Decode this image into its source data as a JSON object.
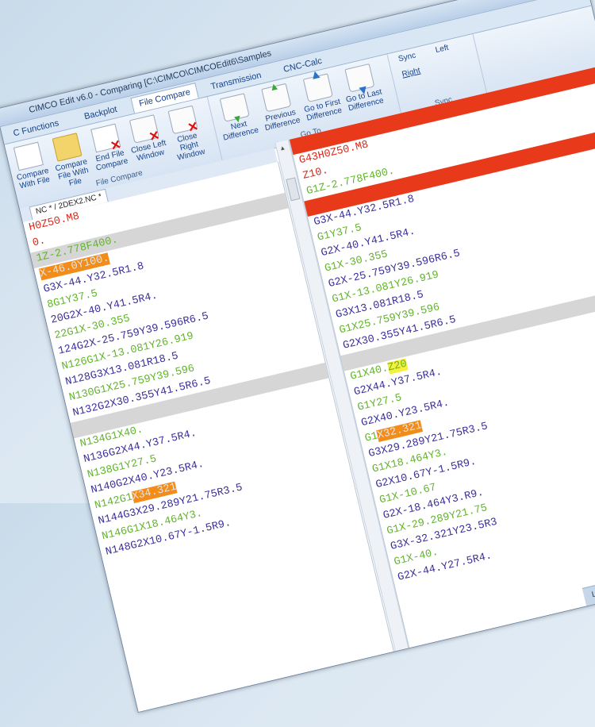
{
  "window": {
    "title": "CIMCO Edit v6.0 - Comparing [C:\\CIMCO\\CIMCOEdit6\\Samples"
  },
  "ribbon_tabs": [
    "C Functions",
    "Backplot",
    "File Compare",
    "Transmission",
    "CNC-Calc"
  ],
  "ribbon": {
    "file_compare_group": {
      "label": "File Compare",
      "buttons": [
        {
          "label": "Compare With File",
          "icon": "compare-file-icon"
        },
        {
          "label": "Compare File With File",
          "icon": "folder-icon"
        },
        {
          "label": "End File Compare",
          "icon": "end-compare-icon"
        },
        {
          "label": "Close Left Window",
          "icon": "close-left-icon"
        },
        {
          "label": "Close Right Window",
          "icon": "close-right-icon"
        }
      ]
    },
    "goto_group": {
      "label": "Go To",
      "buttons": [
        {
          "label": "Next Difference",
          "icon": "next-difference-icon"
        },
        {
          "label": "Previous Difference",
          "icon": "previous-difference-icon"
        },
        {
          "label": "Go to First Difference",
          "icon": "first-difference-icon"
        },
        {
          "label": "Go to Last Difference",
          "icon": "last-difference-icon"
        }
      ]
    },
    "sync_group": {
      "label": "Sync",
      "items": [
        "Sync",
        "Right",
        "Left"
      ]
    }
  },
  "file_tab": "NC * / 2DEX2.NC *",
  "left_pane": [
    {
      "segments": [
        {
          "t": "H0Z50.M8",
          "c": "red"
        }
      ],
      "bg": ""
    },
    {
      "segments": [
        {
          "t": "0.",
          "c": "red"
        }
      ],
      "bg": ""
    },
    {
      "segments": [
        {
          "t": "1Z-2.778F400.",
          "c": "green"
        }
      ],
      "bg": "gray"
    },
    {
      "segments": [
        {
          "t": "X-46.0Y100.",
          "c": "hl-orange"
        }
      ],
      "bg": ""
    },
    {
      "segments": [
        {
          "t": "G3X-44.Y32.5R1.8",
          "c": "blue"
        }
      ],
      "bg": ""
    },
    {
      "segments": [
        {
          "t": "8G1Y37.5",
          "c": "green"
        }
      ],
      "bg": ""
    },
    {
      "segments": [
        {
          "t": "20G2X-40.Y41.5R4.",
          "c": "blue"
        }
      ],
      "bg": ""
    },
    {
      "segments": [
        {
          "t": "22G1X-30.355",
          "c": "green"
        }
      ],
      "bg": ""
    },
    {
      "segments": [
        {
          "t": "124G2X-25.759Y39.596R6.5",
          "c": "blue"
        }
      ],
      "bg": ""
    },
    {
      "segments": [
        {
          "t": "N126G1X-13.081Y26.919",
          "c": "green"
        }
      ],
      "bg": ""
    },
    {
      "segments": [
        {
          "t": "N128G3X13.081R18.5",
          "c": "blue"
        }
      ],
      "bg": ""
    },
    {
      "segments": [
        {
          "t": "N130G1X25.759Y39.596",
          "c": "green"
        }
      ],
      "bg": ""
    },
    {
      "segments": [
        {
          "t": "N132G2X30.355Y41.5R6.5",
          "c": "blue"
        }
      ],
      "bg": ""
    },
    {
      "segments": [
        {
          "t": "",
          "c": "blue"
        }
      ],
      "bg": "gray"
    },
    {
      "segments": [
        {
          "t": "N134G1X40.",
          "c": "green"
        }
      ],
      "bg": ""
    },
    {
      "segments": [
        {
          "t": "N136G2X44.Y37.5R4.",
          "c": "blue"
        }
      ],
      "bg": ""
    },
    {
      "segments": [
        {
          "t": "N138G1Y27.5",
          "c": "green"
        }
      ],
      "bg": ""
    },
    {
      "segments": [
        {
          "t": "N140G2X40.Y23.5R4.",
          "c": "blue"
        }
      ],
      "bg": ""
    },
    {
      "segments": [
        {
          "t": "N142G1",
          "c": "green"
        },
        {
          "t": "X34.321",
          "c": "hl-orange"
        }
      ],
      "bg": ""
    },
    {
      "segments": [
        {
          "t": "N144G3X29.289Y21.75R3.5",
          "c": "blue"
        }
      ],
      "bg": ""
    },
    {
      "segments": [
        {
          "t": "N146G1X18.464Y3.",
          "c": "green"
        }
      ],
      "bg": ""
    },
    {
      "segments": [
        {
          "t": "N148G2X10.67Y-1.5R9.",
          "c": "blue"
        }
      ],
      "bg": ""
    }
  ],
  "right_pane": [
    {
      "segments": [
        {
          "t": "",
          "c": "red"
        }
      ],
      "bg": "red-band"
    },
    {
      "segments": [
        {
          "t": "G43H0Z50.M8",
          "c": "red"
        }
      ],
      "bg": ""
    },
    {
      "segments": [
        {
          "t": "Z10.",
          "c": "red"
        }
      ],
      "bg": ""
    },
    {
      "segments": [
        {
          "t": "G1Z-2.778F400.",
          "c": "green"
        }
      ],
      "bg": ""
    },
    {
      "segments": [
        {
          "t": "",
          "c": "red"
        }
      ],
      "bg": "red-band"
    },
    {
      "segments": [
        {
          "t": "G3X-44.Y32.5R1.8",
          "c": "blue"
        }
      ],
      "bg": ""
    },
    {
      "segments": [
        {
          "t": "G1Y37.5",
          "c": "green"
        }
      ],
      "bg": ""
    },
    {
      "segments": [
        {
          "t": "G2X-40.Y41.5R4.",
          "c": "blue"
        }
      ],
      "bg": ""
    },
    {
      "segments": [
        {
          "t": "G1X-30.355",
          "c": "green"
        }
      ],
      "bg": ""
    },
    {
      "segments": [
        {
          "t": "G2X-25.759Y39.596R6.5",
          "c": "blue"
        }
      ],
      "bg": ""
    },
    {
      "segments": [
        {
          "t": "G1X-13.081Y26.919",
          "c": "green"
        }
      ],
      "bg": ""
    },
    {
      "segments": [
        {
          "t": "G3X13.081R18.5",
          "c": "blue"
        }
      ],
      "bg": ""
    },
    {
      "segments": [
        {
          "t": "G1X25.759Y39.596",
          "c": "green"
        }
      ],
      "bg": ""
    },
    {
      "segments": [
        {
          "t": "G2X30.355Y41.5R6.5",
          "c": "blue"
        }
      ],
      "bg": ""
    },
    {
      "segments": [
        {
          "t": "",
          "c": "blue"
        }
      ],
      "bg": "gray"
    },
    {
      "segments": [
        {
          "t": "G1X40.",
          "c": "green"
        },
        {
          "t": "Z20",
          "c": "hl-yellow"
        }
      ],
      "bg": ""
    },
    {
      "segments": [
        {
          "t": "G2X44.Y37.5R4.",
          "c": "blue"
        }
      ],
      "bg": ""
    },
    {
      "segments": [
        {
          "t": "G1Y27.5",
          "c": "green"
        }
      ],
      "bg": ""
    },
    {
      "segments": [
        {
          "t": "G2X40.Y23.5R4.",
          "c": "blue"
        }
      ],
      "bg": ""
    },
    {
      "segments": [
        {
          "t": "G1",
          "c": "green"
        },
        {
          "t": "X32.321",
          "c": "hl-orange"
        }
      ],
      "bg": ""
    },
    {
      "segments": [
        {
          "t": "G3X29.289Y21.75R3.5",
          "c": "blue"
        }
      ],
      "bg": ""
    },
    {
      "segments": [
        {
          "t": "G1X18.464Y3.",
          "c": "green"
        }
      ],
      "bg": ""
    },
    {
      "segments": [
        {
          "t": "G2X10.67Y-1.5R9.",
          "c": "blue"
        }
      ],
      "bg": ""
    },
    {
      "segments": [
        {
          "t": "G1X-10.67",
          "c": "green"
        }
      ],
      "bg": ""
    },
    {
      "segments": [
        {
          "t": "G2X-18.464Y3.R9.",
          "c": "blue"
        }
      ],
      "bg": ""
    },
    {
      "segments": [
        {
          "t": "G1X-29.289Y21.75",
          "c": "green"
        }
      ],
      "bg": ""
    },
    {
      "segments": [
        {
          "t": "G3X-32.321Y23.5R3",
          "c": "blue"
        }
      ],
      "bg": ""
    },
    {
      "segments": [
        {
          "t": "G1X-40.",
          "c": "green"
        }
      ],
      "bg": ""
    },
    {
      "segments": [
        {
          "t": "G2X-44.Y27.5R4.",
          "c": "blue"
        }
      ],
      "bg": ""
    }
  ],
  "status": {
    "text": "Licensed to Atlas"
  },
  "colors": {
    "red": "#d62a1c",
    "green": "#62b42c",
    "blue": "#3b2f9a",
    "orange_highlight": "#f28c1a",
    "yellow_highlight": "#f6f03a",
    "red_band": "#e8391b"
  }
}
